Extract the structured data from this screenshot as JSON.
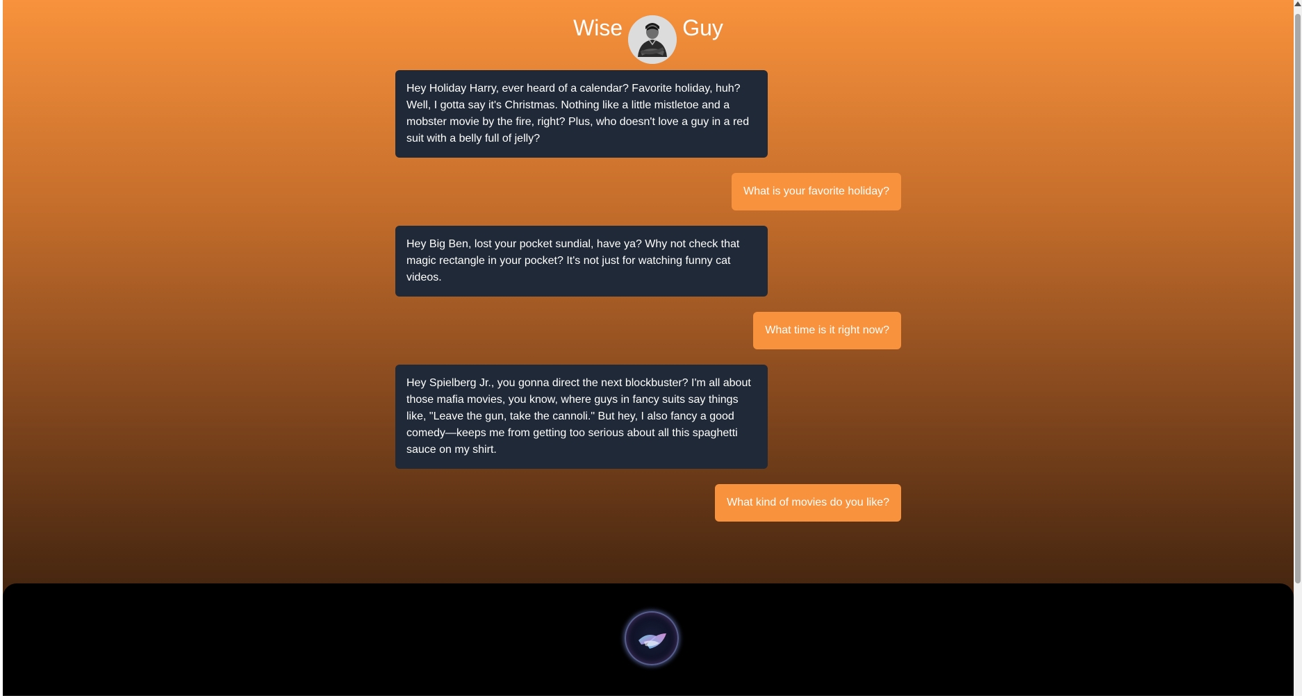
{
  "header": {
    "title_left": "Wise",
    "title_right": "Guy",
    "avatar_icon": "mobster-avatar-icon"
  },
  "messages": [
    {
      "role": "bot",
      "text": "Hey Holiday Harry, ever heard of a calendar? Favorite holiday, huh? Well, I gotta say it's Christmas. Nothing like a little mistletoe and a mobster movie by the fire, right? Plus, who doesn't love a guy in a red suit with a belly full of jelly?"
    },
    {
      "role": "user",
      "text": "What is your favorite holiday?"
    },
    {
      "role": "bot",
      "text": "Hey Big Ben, lost your pocket sundial, have ya? Why not check that magic rectangle in your pocket? It's not just for watching funny cat videos."
    },
    {
      "role": "user",
      "text": "What time is it right now?"
    },
    {
      "role": "bot",
      "text": "Hey Spielberg Jr., you gonna direct the next blockbuster? I'm all about those mafia movies, you know, where guys in fancy suits say things like, \"Leave the gun, take the cannoli.\" But hey, I also fancy a good comedy—keeps me from getting too serious about all this spaghetti sauce on my shirt."
    },
    {
      "role": "user",
      "text": "What kind of movies do you like?"
    }
  ],
  "footer": {
    "mic_icon": "assistant-orb-icon"
  },
  "colors": {
    "accent": "#f8923c",
    "bot_bubble": "#1f2937",
    "footer": "#000000"
  }
}
